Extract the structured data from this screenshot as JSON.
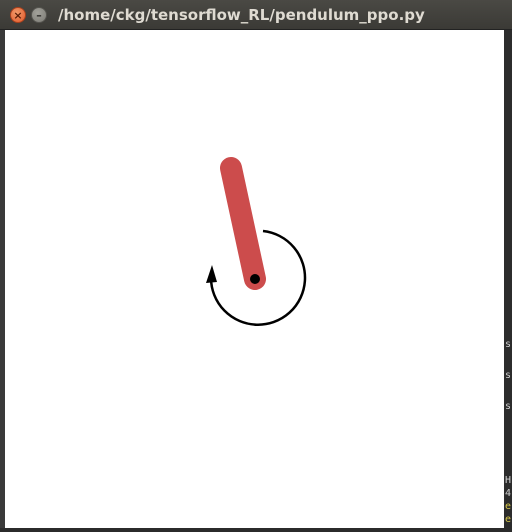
{
  "window": {
    "title": "/home/ckg/tensorflow_RL/pendulum_ppo.py",
    "close_symbol": "×",
    "minimize_symbol": "–"
  },
  "pendulum": {
    "pole_color": "#cc4c4c",
    "pivot_color": "#000000",
    "arrow_color": "#000000"
  },
  "background_terminal": {
    "chars": [
      "s",
      "s",
      "s",
      "H",
      "4",
      "e",
      "e"
    ]
  }
}
